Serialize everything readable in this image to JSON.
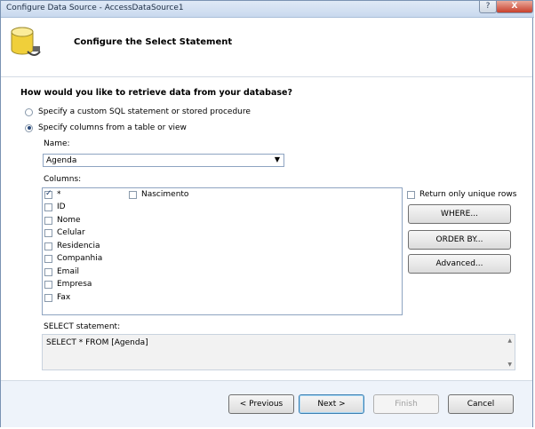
{
  "window": {
    "title": "Configure Data Source - AccessDataSource1",
    "help_label": "?",
    "close_label": "X"
  },
  "header": {
    "title": "Configure the Select Statement"
  },
  "main": {
    "question": "How would you like to retrieve data from your database?",
    "radio_custom": "Specify a custom SQL statement or stored procedure",
    "radio_columns": "Specify columns from a table or view",
    "radio_selected": "columns",
    "name_label": "Name:",
    "name_value": "Agenda",
    "columns_label": "Columns:",
    "columns": [
      {
        "label": "*",
        "checked": true
      },
      {
        "label": "ID",
        "checked": false
      },
      {
        "label": "Nome",
        "checked": false
      },
      {
        "label": "Celular",
        "checked": false
      },
      {
        "label": "Residencia",
        "checked": false
      },
      {
        "label": "Companhia",
        "checked": false
      },
      {
        "label": "Email",
        "checked": false
      },
      {
        "label": "Empresa",
        "checked": false
      },
      {
        "label": "Fax",
        "checked": false
      },
      {
        "label": "Nascimento",
        "checked": false
      }
    ],
    "unique_rows_label": "Return only unique rows",
    "where_label": "WHERE...",
    "order_by_label": "ORDER BY...",
    "advanced_label": "Advanced...",
    "select_label": "SELECT statement:",
    "select_value": "SELECT * FROM [Agenda]"
  },
  "footer": {
    "previous_label": "< Previous",
    "next_label": "Next >",
    "finish_label": "Finish",
    "cancel_label": "Cancel"
  },
  "colors": {
    "titlebar": "#c9d9ee",
    "close": "#c8402c",
    "default_button_border": "#3c7fb1"
  }
}
